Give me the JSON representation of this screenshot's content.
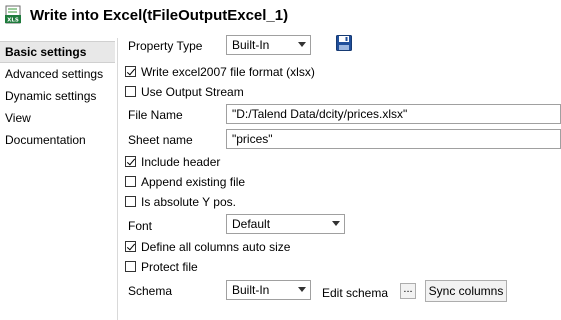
{
  "title": "Write into Excel(tFileOutputExcel_1)",
  "sidebar": {
    "items": [
      {
        "label": "Basic settings"
      },
      {
        "label": "Advanced settings"
      },
      {
        "label": "Dynamic settings"
      },
      {
        "label": "View"
      },
      {
        "label": "Documentation"
      }
    ]
  },
  "form": {
    "property_type_label": "Property Type",
    "property_type_value": "Built-In",
    "excel2007_label": "Write excel2007 file format (xlsx)",
    "use_output_stream_label": "Use Output Stream",
    "file_name_label": "File Name",
    "file_name_value": "\"D:/Talend Data/dcity/prices.xlsx\"",
    "sheet_name_label": "Sheet name",
    "sheet_name_value": "\"prices\"",
    "include_header_label": "Include header",
    "append_existing_label": "Append existing file",
    "absolute_y_label": "Is absolute Y pos.",
    "font_label": "Font",
    "font_value": "Default",
    "auto_size_label": "Define all columns auto size",
    "protect_file_label": "Protect file",
    "schema_label": "Schema",
    "schema_value": "Built-In",
    "edit_schema_label": "Edit schema",
    "edit_schema_button": "...",
    "sync_columns_button": "Sync columns"
  },
  "checkbox_states": {
    "excel2007": true,
    "use_output_stream": false,
    "include_header": true,
    "append_existing": false,
    "absolute_y": false,
    "auto_size": true,
    "protect_file": false
  },
  "icons": {
    "title": "excel-xlsx-icon",
    "save": "floppy-disk-icon"
  },
  "colors": {
    "excel_green": "#1e7b3c",
    "save_blue": "#1f4e9a"
  }
}
